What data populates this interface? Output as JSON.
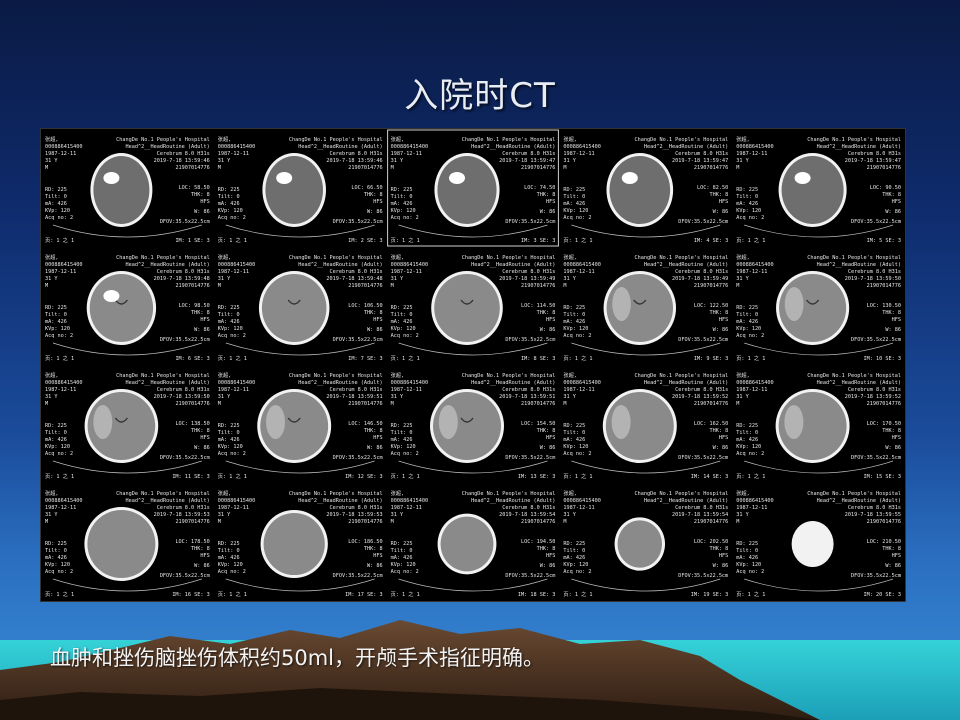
{
  "slide": {
    "title": "入院时CT",
    "caption": "血肿和挫伤脑挫伤体积约50ml，开颅手术指征明确。"
  },
  "ct_sheet": {
    "hospital": "ChangDe No.1 People's Hospital",
    "patient_name": "张超,",
    "patient_id": "000886415400",
    "birth_date": "1987-12-11",
    "age": "31 Y",
    "sex": "M",
    "protocol": "Head^2__HeadRoutine (Adult)",
    "series_desc": "Cerebrum  8.0  H31s",
    "accession": "21907014776",
    "rd": "RD: 225",
    "tilt": "Tilt: 0",
    "ma": "mA: 426",
    "kvp": "KVp: 120",
    "acq": "Acq no: 2",
    "thk": "THK: 8",
    "orient": "HFS",
    "window": "W: 86",
    "dfov": "DFOV:35.5x22.5cm",
    "page": "页: 1 之 1",
    "images": [
      {
        "im": "IM: 1 SE: 3",
        "loc": "LOC: 58.50",
        "time": "2019-7-18 13:59:46"
      },
      {
        "im": "IM: 2 SE: 3",
        "loc": "LOC: 66.50",
        "time": "2019-7-18 13:59:46"
      },
      {
        "im": "IM: 3 SE: 3",
        "loc": "LOC: 74.50",
        "time": "2019-7-18 13:59:47"
      },
      {
        "im": "IM: 4 SE: 3",
        "loc": "LOC: 82.50",
        "time": "2019-7-18 13:59:47"
      },
      {
        "im": "IM: 5 SE: 3",
        "loc": "LOC: 90.50",
        "time": "2019-7-18 13:59:47"
      },
      {
        "im": "IM: 6 SE: 3",
        "loc": "LOC: 98.50",
        "time": "2019-7-18 13:59:48"
      },
      {
        "im": "IM: 7 SE: 3",
        "loc": "LOC: 106.50",
        "time": "2019-7-18 13:59:48"
      },
      {
        "im": "IM: 8 SE: 3",
        "loc": "LOC: 114.50",
        "time": "2019-7-18 13:59:49"
      },
      {
        "im": "IM: 9 SE: 3",
        "loc": "LOC: 122.50",
        "time": "2019-7-18 13:59:49"
      },
      {
        "im": "IM: 10 SE: 3",
        "loc": "LOC: 130.50",
        "time": "2019-7-18 13:59:50"
      },
      {
        "im": "IM: 11 SE: 3",
        "loc": "LOC: 138.50",
        "time": "2019-7-18 13:59:50"
      },
      {
        "im": "IM: 12 SE: 3",
        "loc": "LOC: 146.50",
        "time": "2019-7-18 13:59:51"
      },
      {
        "im": "IM: 13 SE: 3",
        "loc": "LOC: 154.50",
        "time": "2019-7-18 13:59:51"
      },
      {
        "im": "IM: 14 SE: 3",
        "loc": "LOC: 162.50",
        "time": "2019-7-18 13:59:52"
      },
      {
        "im": "IM: 15 SE: 3",
        "loc": "LOC: 170.50",
        "time": "2019-7-18 13:59:52"
      },
      {
        "im": "IM: 16 SE: 3",
        "loc": "LOC: 178.50",
        "time": "2019-7-18 13:59:53"
      },
      {
        "im": "IM: 17 SE: 3",
        "loc": "LOC: 186.50",
        "time": "2019-7-18 13:59:53"
      },
      {
        "im": "IM: 18 SE: 3",
        "loc": "LOC: 194.50",
        "time": "2019-7-18 13:59:54"
      },
      {
        "im": "IM: 19 SE: 3",
        "loc": "LOC: 202.50",
        "time": "2019-7-18 13:59:54"
      },
      {
        "im": "IM: 20 SE: 3",
        "loc": "LOC: 210.50",
        "time": "2019-7-18 13:59:55"
      }
    ]
  }
}
